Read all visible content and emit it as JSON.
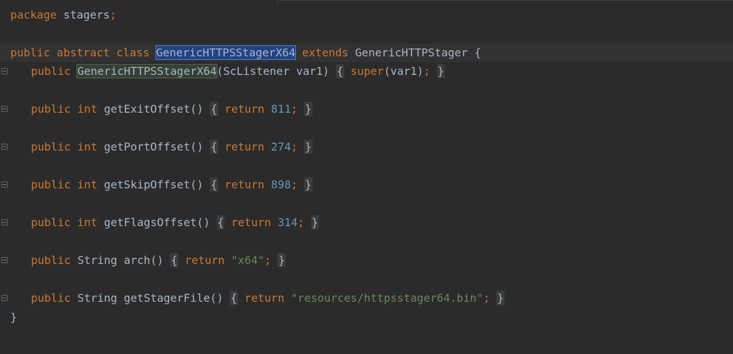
{
  "editor": {
    "language": "java",
    "colors": {
      "background": "#2b2b2b",
      "keyword": "#cc7832",
      "number": "#6897bb",
      "string": "#6a8759",
      "text": "#a9b7c6",
      "selection": "#214283",
      "usage_highlight": "#344134"
    },
    "fold_icon": "fold-minus-icon"
  },
  "code": {
    "l1": {
      "kw_package": "package",
      "name": " stagers",
      "semi": ";"
    },
    "l3": {
      "kw_modifiers": "public abstract class ",
      "class_name": "GenericHTTPSStagerX64",
      "kw_extends": " extends ",
      "super_class": "GenericHTTPStager {"
    },
    "l4": {
      "kw_public": "public ",
      "ctor_name": "GenericHTTPSStagerX64",
      "params": "(ScListener var1) ",
      "brace_open": "{",
      "kw_super": " super",
      "call": "(var1)",
      "semi": ";",
      "brace_close": "}"
    },
    "methods": [
      {
        "kw": "public int ",
        "name": "getExitOffset() ",
        "ret": " return ",
        "value": "811",
        "semi": ";",
        "kind": "num"
      },
      {
        "kw": "public int ",
        "name": "getPortOffset() ",
        "ret": " return ",
        "value": "274",
        "semi": ";",
        "kind": "num"
      },
      {
        "kw": "public int ",
        "name": "getSkipOffset() ",
        "ret": " return ",
        "value": "898",
        "semi": ";",
        "kind": "num"
      },
      {
        "kw": "public int ",
        "name": "getFlagsOffset() ",
        "ret": " return ",
        "value": "314",
        "semi": ";",
        "kind": "num"
      },
      {
        "kw": "public ",
        "type": "String ",
        "name": "arch() ",
        "ret": " return ",
        "value": "\"x64\"",
        "semi": ";",
        "kind": "str"
      },
      {
        "kw": "public ",
        "type": "String ",
        "name": "getStagerFile() ",
        "ret": " return ",
        "value": "\"resources/httpsstager64.bin\"",
        "semi": ";",
        "kind": "str"
      }
    ],
    "closing": "}"
  }
}
